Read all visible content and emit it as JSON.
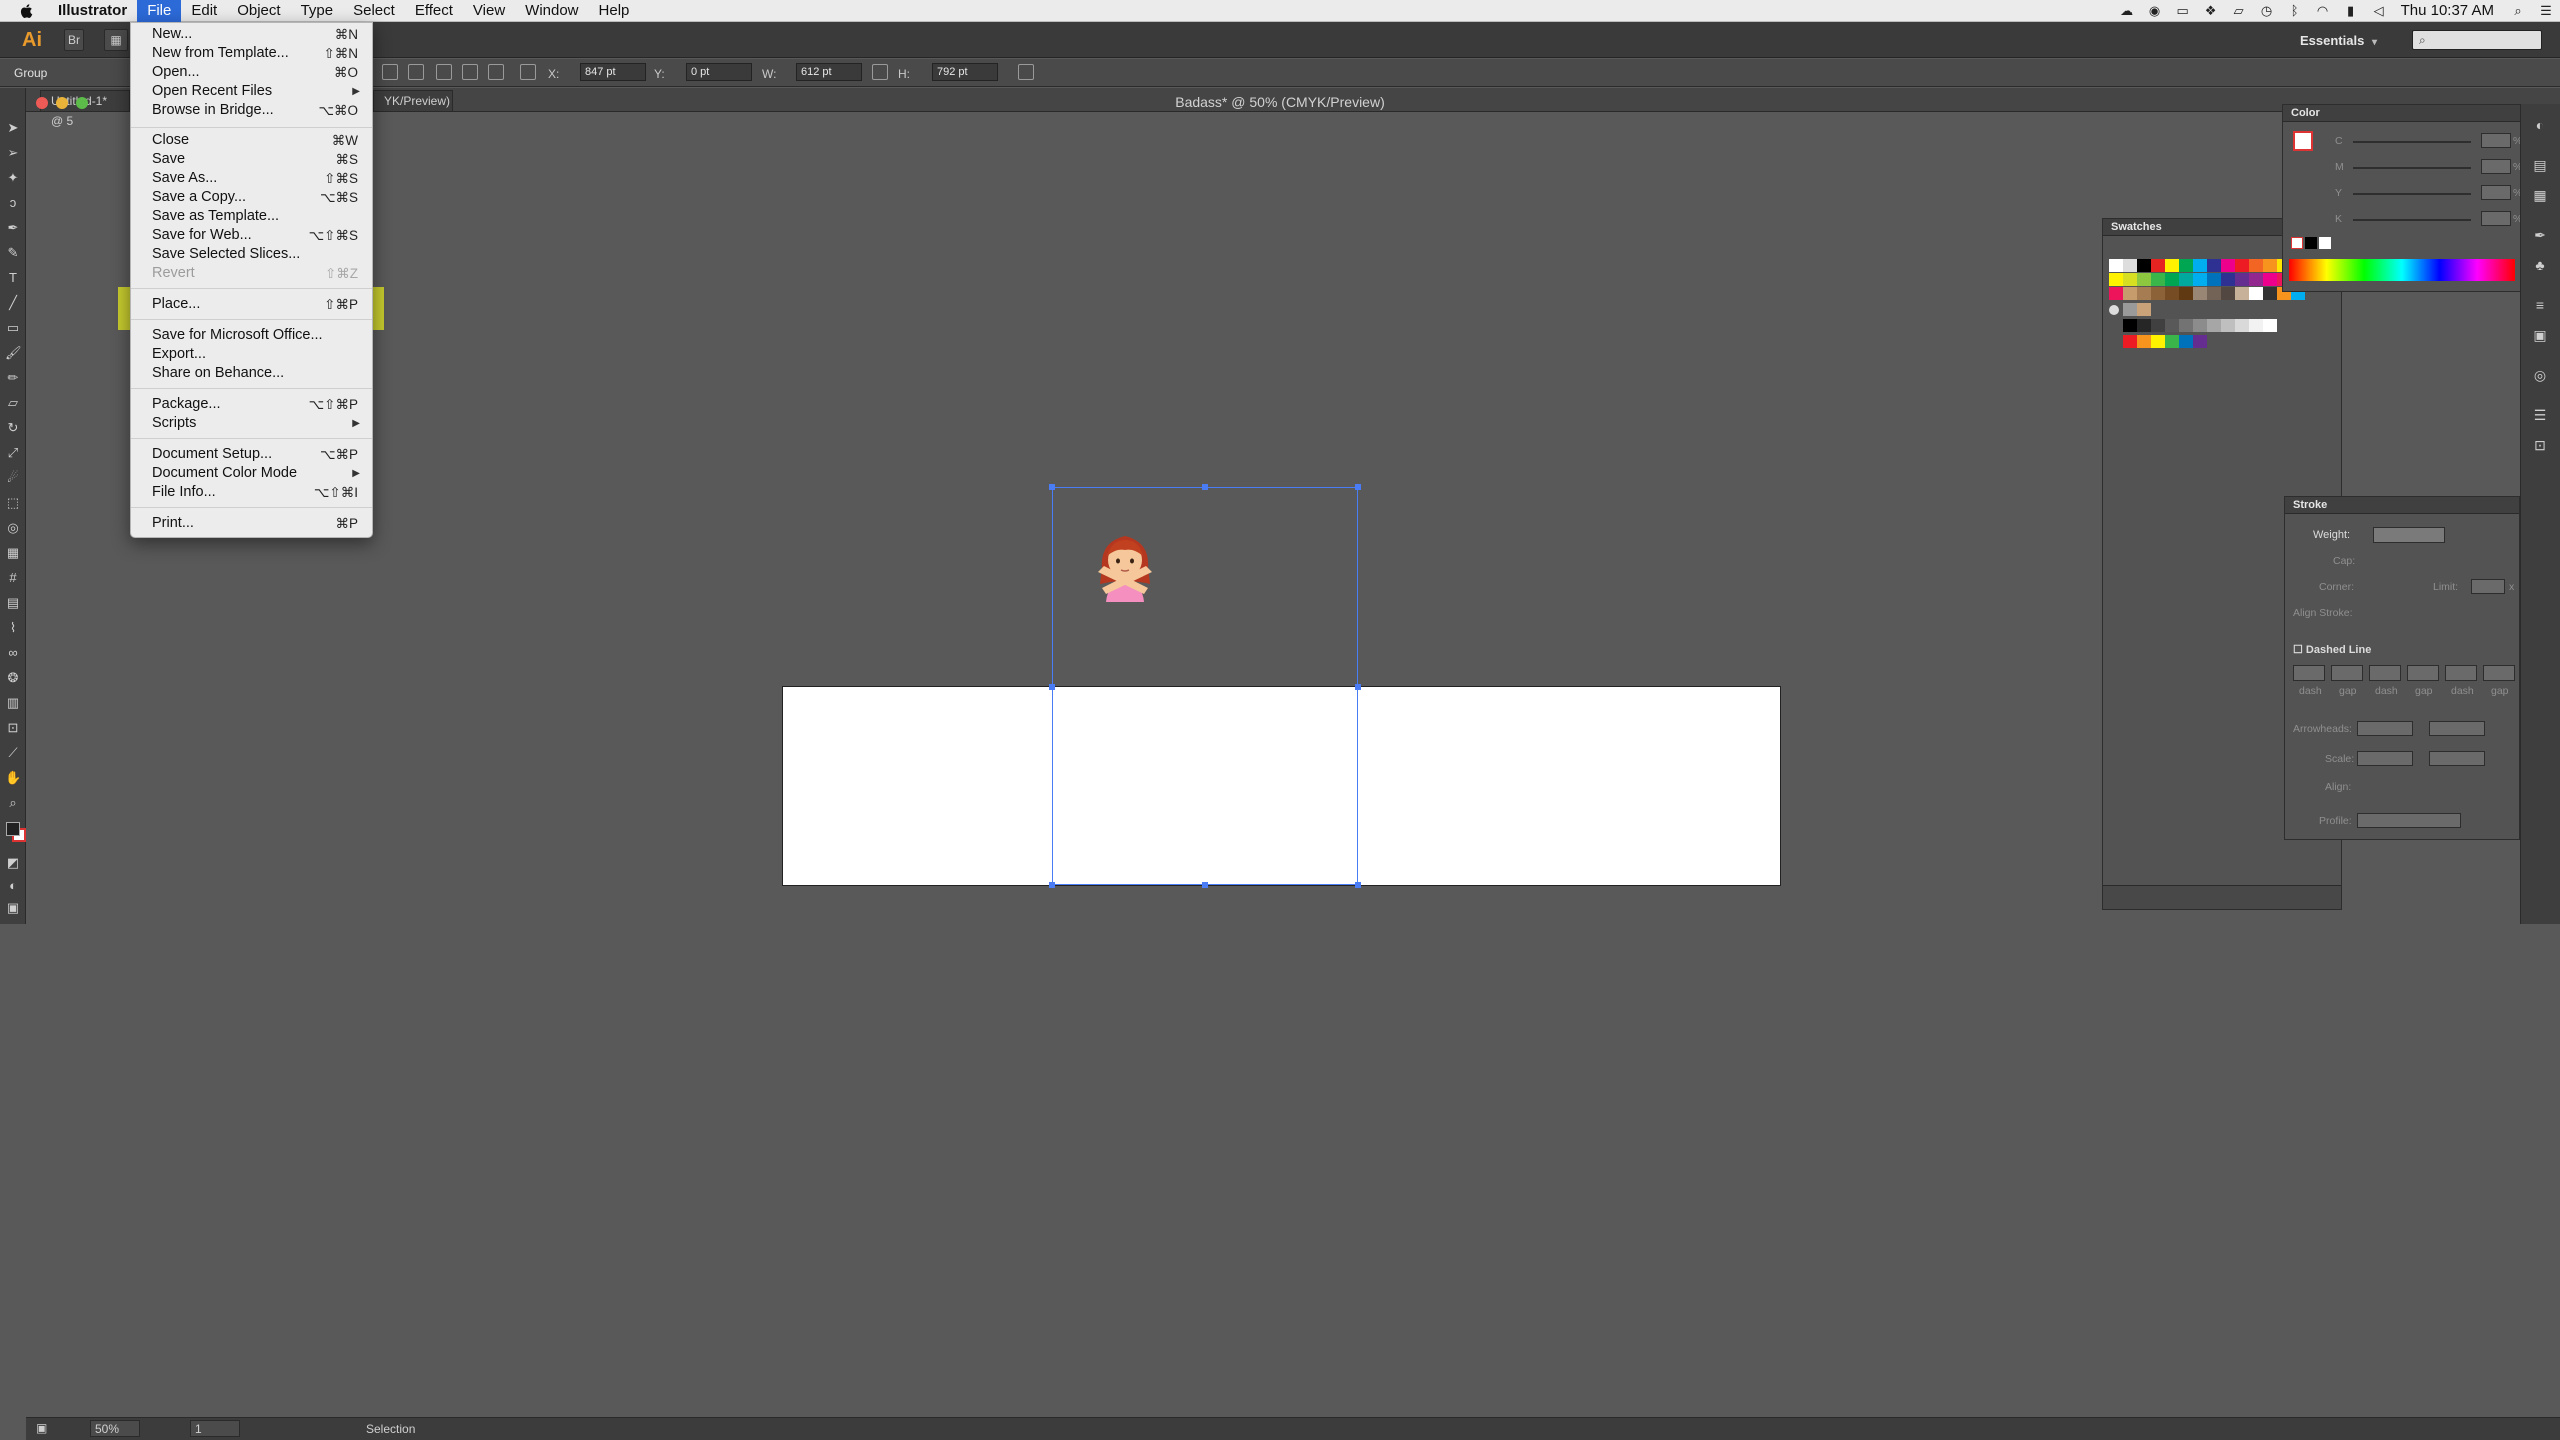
{
  "menubar": {
    "app_name": "Illustrator",
    "items": [
      "File",
      "Edit",
      "Object",
      "Type",
      "Select",
      "Effect",
      "View",
      "Window",
      "Help"
    ],
    "active": "File",
    "clock": "Thu 10:37 AM"
  },
  "appbar": {
    "logo": "Ai",
    "br_label": "Br",
    "workspace": "Essentials",
    "workspace_arrow": "▾",
    "search_glyph": "⌕"
  },
  "controlbar": {
    "selection_type": "Group",
    "x_label": "X:",
    "x_value": "847 pt",
    "y_label": "Y:",
    "y_value": "0 pt",
    "w_label": "W:",
    "w_value": "612 pt",
    "h_label": "H:",
    "h_value": "792 pt"
  },
  "tabs": {
    "untitled": "Untitled-1* @ 5",
    "partial": "YK/Preview)",
    "title": "Badass* @ 50% (CMYK/Preview)"
  },
  "file_menu": {
    "items": [
      {
        "label": "New...",
        "shortcut": "⌘N"
      },
      {
        "label": "New from Template...",
        "shortcut": "⇧⌘N"
      },
      {
        "label": "Open...",
        "shortcut": "⌘O"
      },
      {
        "label": "Open Recent Files",
        "shortcut": "▶"
      },
      {
        "label": "Browse in Bridge...",
        "shortcut": "⌥⌘O"
      },
      {
        "label": "Close",
        "shortcut": "⌘W"
      },
      {
        "label": "Save",
        "shortcut": "⌘S"
      },
      {
        "label": "Save As...",
        "shortcut": "⇧⌘S"
      },
      {
        "label": "Save a Copy...",
        "shortcut": "⌥⌘S"
      },
      {
        "label": "Save as Template...",
        "shortcut": ""
      },
      {
        "label": "Save for Web...",
        "shortcut": "⌥⇧⌘S"
      },
      {
        "label": "Save Selected Slices...",
        "shortcut": ""
      },
      {
        "label": "Revert",
        "shortcut": "⇧⌘Z"
      },
      {
        "label": "Place...",
        "shortcut": "⇧⌘P"
      },
      {
        "label": "Save for Microsoft Office...",
        "shortcut": ""
      },
      {
        "label": "Export...",
        "shortcut": ""
      },
      {
        "label": "Share on Behance...",
        "shortcut": ""
      },
      {
        "label": "Package...",
        "shortcut": "⌥⇧⌘P"
      },
      {
        "label": "Scripts",
        "shortcut": "▶"
      },
      {
        "label": "Document Setup...",
        "shortcut": "⌥⌘P"
      },
      {
        "label": "Document Color Mode",
        "shortcut": "▶"
      },
      {
        "label": "File Info...",
        "shortcut": "⌥⇧⌘I"
      },
      {
        "label": "Print...",
        "shortcut": "⌘P"
      }
    ],
    "highlight_color": "#d4da28"
  },
  "color_panel": {
    "title": "Color",
    "channels": [
      "C",
      "M",
      "Y",
      "K"
    ],
    "percent": "%"
  },
  "swatches_panel": {
    "title": "Swatches"
  },
  "stroke_panel": {
    "title": "Stroke",
    "weight_label": "Weight:",
    "cap_label": "Cap:",
    "corner_label": "Corner:",
    "limit_label": "Limit:",
    "limit_unit": "x",
    "align_label": "Align Stroke:",
    "dashed_label": "Dashed Line",
    "dash_labels": [
      "dash",
      "gap",
      "dash",
      "gap",
      "dash",
      "gap"
    ],
    "arrowheads_label": "Arrowheads:",
    "scale_label": "Scale:",
    "align2_label": "Align:",
    "profile_label": "Profile:"
  },
  "statusbar": {
    "zoom": "50%",
    "artboard_num": "1",
    "tool": "Selection"
  },
  "colors": {
    "canvas": "#595959",
    "selection": "#4a7cf6",
    "menu_active": "#2c6ad8"
  }
}
